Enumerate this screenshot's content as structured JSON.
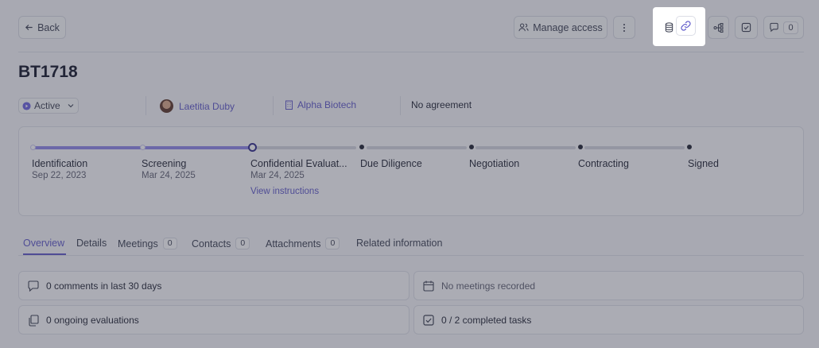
{
  "header": {
    "back_label": "Back",
    "manage_access_label": "Manage access",
    "comments_count": "0"
  },
  "record": {
    "title": "BT1718",
    "status": "Active",
    "owner": "Laetitia Duby",
    "company": "Alpha Biotech",
    "agreement": "No agreement"
  },
  "stages": [
    {
      "name": "Identification",
      "date": "Sep 22, 2023"
    },
    {
      "name": "Screening",
      "date": "Mar 24, 2025"
    },
    {
      "name": "Confidential Evaluat...",
      "date": "Mar 24, 2025",
      "link": "View instructions"
    },
    {
      "name": "Due Diligence",
      "date": ""
    },
    {
      "name": "Negotiation",
      "date": ""
    },
    {
      "name": "Contracting",
      "date": ""
    },
    {
      "name": "Signed",
      "date": ""
    }
  ],
  "tabs": [
    {
      "label": "Overview",
      "count": ""
    },
    {
      "label": "Details",
      "count": ""
    },
    {
      "label": "Meetings",
      "count": "0"
    },
    {
      "label": "Contacts",
      "count": "0"
    },
    {
      "label": "Attachments",
      "count": "0"
    },
    {
      "label": "Related information",
      "count": ""
    }
  ],
  "summary": {
    "comments": "0 comments in last 30 days",
    "meetings": "No meetings recorded",
    "evaluations": "0 ongoing evaluations",
    "tasks": "0 / 2 completed tasks"
  },
  "icons": [
    "arrow-left-icon",
    "users-icon",
    "more-vertical-icon",
    "database-icon",
    "link-icon",
    "tree-icon",
    "checkbox-icon",
    "comment-icon",
    "play-circle-icon",
    "chevron-down-icon",
    "building-icon",
    "calendar-icon",
    "copy-icon"
  ],
  "colors": {
    "accent": "#5d57c9",
    "progress": "#8f87e8"
  }
}
